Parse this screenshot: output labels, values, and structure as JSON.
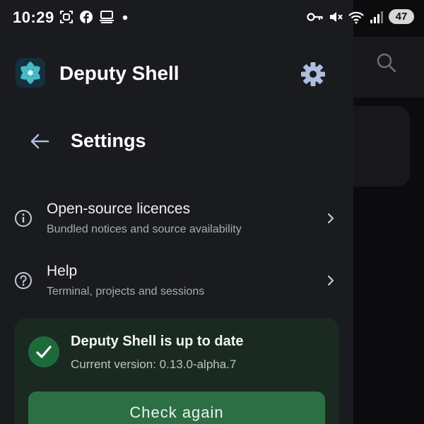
{
  "status_bar": {
    "time": "10:29",
    "left_icons": [
      "screenshot-icon",
      "facebook-icon",
      "desktop-icon",
      "dot-icon"
    ],
    "right_icons": [
      "vpn-key-icon",
      "mute-icon",
      "wifi-icon",
      "signal-icon"
    ],
    "battery": "47"
  },
  "drawer": {
    "app_name": "Deputy Shell",
    "settings_title": "Settings",
    "items": [
      {
        "icon": "info-icon",
        "title": "Open-source licences",
        "subtitle": "Bundled notices and source availability"
      },
      {
        "icon": "help-icon",
        "title": "Help",
        "subtitle": "Terminal, projects and sessions"
      }
    ],
    "update": {
      "status": "Deputy Shell is up to date",
      "version": "Current version: 0.13.0-alpha.7",
      "button_label": "Check again"
    }
  },
  "colors": {
    "drawer_bg": "#1a1b1f",
    "card_bg": "#1a2a20",
    "accent_green": "#2d6f45",
    "icon_blue": "#aebde0"
  }
}
